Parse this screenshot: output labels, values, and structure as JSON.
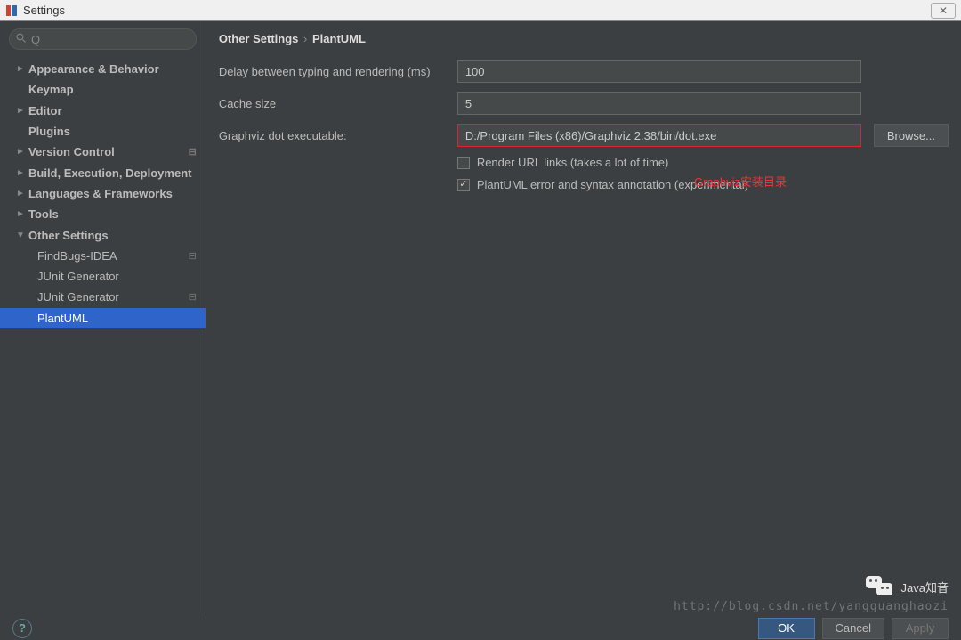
{
  "titlebar": {
    "title": "Settings"
  },
  "search": {
    "placeholder": ""
  },
  "tree": {
    "items": [
      {
        "label": "Appearance & Behavior",
        "arrow": "►",
        "bold": true
      },
      {
        "label": "Keymap",
        "arrow": "",
        "bold": true
      },
      {
        "label": "Editor",
        "arrow": "►",
        "bold": true
      },
      {
        "label": "Plugins",
        "arrow": "",
        "bold": true
      },
      {
        "label": "Version Control",
        "arrow": "►",
        "bold": true,
        "pin": true
      },
      {
        "label": "Build, Execution, Deployment",
        "arrow": "►",
        "bold": true
      },
      {
        "label": "Languages & Frameworks",
        "arrow": "►",
        "bold": true
      },
      {
        "label": "Tools",
        "arrow": "►",
        "bold": true
      },
      {
        "label": "Other Settings",
        "arrow": "▼",
        "bold": true
      },
      {
        "label": "FindBugs-IDEA",
        "arrow": "",
        "child": true,
        "pin": true
      },
      {
        "label": "JUnit Generator",
        "arrow": "",
        "child": true
      },
      {
        "label": "JUnit Generator",
        "arrow": "",
        "child": true,
        "pin": true
      },
      {
        "label": "PlantUML",
        "arrow": "",
        "child": true,
        "selected": true
      }
    ]
  },
  "breadcrumb": {
    "a": "Other Settings",
    "b": "PlantUML"
  },
  "form": {
    "delay_label": "Delay between typing and rendering (ms)",
    "delay_value": "100",
    "cache_label": "Cache size",
    "cache_value": "5",
    "graphviz_label": "Graphviz dot executable:",
    "graphviz_value": "D:/Program Files (x86)/Graphviz 2.38/bin/dot.exe",
    "browse_label": "Browse...",
    "render_url_label": "Render URL links (takes a lot of time)",
    "error_anno_label": "PlantUML error and syntax annotation (experimental)",
    "annotation": "Graphviz安装目录"
  },
  "buttons": {
    "help": "?",
    "ok": "OK",
    "cancel": "Cancel",
    "apply": "Apply"
  },
  "watermark": {
    "brand": "Java知音",
    "url": "http://blog.csdn.net/yangguanghaozi"
  }
}
